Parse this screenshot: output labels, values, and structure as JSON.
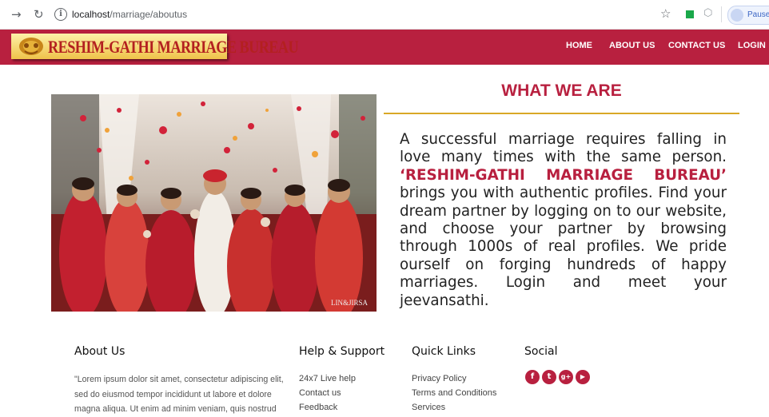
{
  "browser": {
    "url_host": "localhost",
    "url_path": "/marriage/aboutus",
    "profile_label": "Paused"
  },
  "header": {
    "logo_text": "RESHIM-GATHI MARRIAGE BUREAU",
    "nav": [
      "HOME",
      "ABOUT US",
      "CONTACT US",
      "LOGIN"
    ]
  },
  "main": {
    "title": "WHAT WE ARE",
    "text_before": "A successful marriage requires falling in love many times with the same person. ",
    "brand_text": "‘RESHIM-GATHI MARRIAGE BUREAU’",
    "text_after": " brings you with authentic profiles. Find your dream partner by logging on to our website, and choose your partner by browsing through 1000s of real profiles. We pride ourself on forging hundreds of happy marriages. Login and meet your jeevansathi.",
    "photo_watermark": "LIN&JIRSA"
  },
  "footer": {
    "about": {
      "heading": "About Us",
      "text": "\"Lorem ipsum dolor sit amet, consectetur adipiscing elit, sed do eiusmod tempor incididunt ut labore et dolore magna aliqua. Ut enim ad minim veniam, quis nostrud"
    },
    "help": {
      "heading": "Help & Support",
      "links": [
        "24x7 Live help",
        "Contact us",
        "Feedback"
      ]
    },
    "quick": {
      "heading": "Quick Links",
      "links": [
        "Privacy Policy",
        "Terms and Conditions",
        "Services"
      ]
    },
    "social": {
      "heading": "Social",
      "icons": [
        {
          "name": "facebook-icon",
          "glyph": "f"
        },
        {
          "name": "twitter-icon",
          "glyph": "t"
        },
        {
          "name": "google-plus-icon",
          "glyph": "g+"
        },
        {
          "name": "youtube-icon",
          "glyph": "▶"
        }
      ]
    }
  },
  "colors": {
    "brand": "#b8203f",
    "accent": "#d9a826"
  }
}
